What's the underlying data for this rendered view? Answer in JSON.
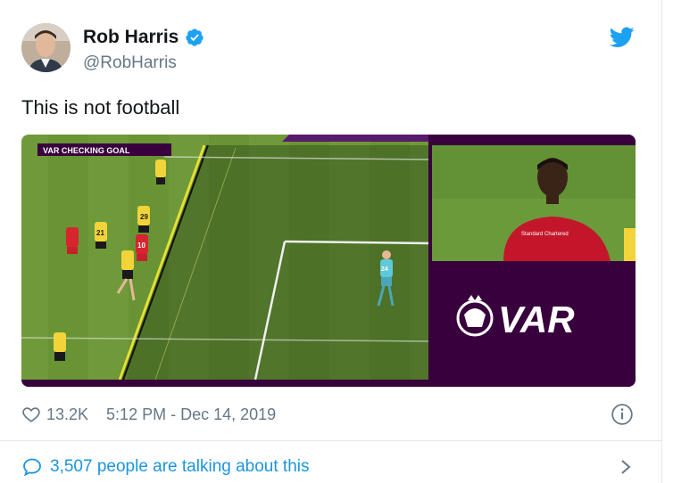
{
  "author": {
    "name": "Rob Harris",
    "handle": "@RobHarris",
    "verified": true
  },
  "tweet": {
    "text": "This is not football"
  },
  "media": {
    "var_banner": "VAR  CHECKING GOAL",
    "var_logo_text": "VAR",
    "player_numbers": [
      "21",
      "29",
      "10",
      "24"
    ],
    "shirt_sponsor": "Standard Chartered"
  },
  "meta": {
    "like_count": "13.2K",
    "timestamp": "5:12 PM - Dec 14, 2019"
  },
  "conversation": {
    "label": "3,507 people are talking about this"
  },
  "colors": {
    "twitter_blue": "#1da1f2",
    "link_blue": "#1b95e0",
    "secondary_text": "#657786",
    "var_purple": "#38003c"
  },
  "icons": [
    "verified-badge-icon",
    "twitter-bird-icon",
    "heart-icon",
    "info-icon",
    "speech-bubble-icon",
    "chevron-right-icon"
  ]
}
